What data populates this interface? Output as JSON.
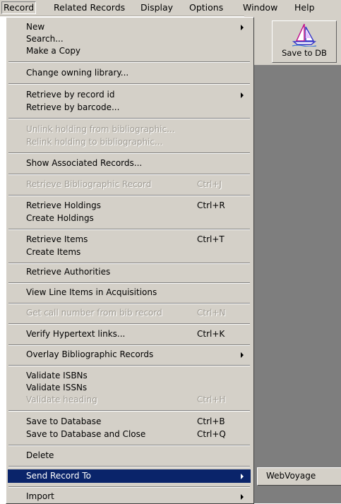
{
  "menubar": {
    "items": [
      "Record",
      "Related Records",
      "Display",
      "Options",
      "Window",
      "Help"
    ]
  },
  "toolbar": {
    "save_label": "Save to DB",
    "save_icon": "sailboat-icon"
  },
  "menu": {
    "items": [
      {
        "label": "New",
        "submenu": true
      },
      {
        "label": "Search..."
      },
      {
        "label": "Make a Copy"
      },
      {
        "label": "Change owning library..."
      },
      {
        "label": "Retrieve by record id",
        "submenu": true
      },
      {
        "label": "Retrieve by barcode..."
      },
      {
        "label": "Unlink holding from bibliographic...",
        "disabled": true
      },
      {
        "label": "Relink holding to bibliographic...",
        "disabled": true
      },
      {
        "label": "Show Associated Records..."
      },
      {
        "label": "Retrieve Bibliographic Record",
        "shortcut": "Ctrl+J",
        "disabled": true
      },
      {
        "label": "Retrieve Holdings",
        "shortcut": "Ctrl+R"
      },
      {
        "label": "Create Holdings"
      },
      {
        "label": "Retrieve Items",
        "shortcut": "Ctrl+T"
      },
      {
        "label": "Create Items"
      },
      {
        "label": "Retrieve Authorities"
      },
      {
        "label": "View Line Items in Acquisitions"
      },
      {
        "label": "Get call number from bib record",
        "shortcut": "Ctrl+N",
        "disabled": true
      },
      {
        "label": "Verify Hypertext links...",
        "shortcut": "Ctrl+K"
      },
      {
        "label": "Overlay Bibliographic Records",
        "submenu": true
      },
      {
        "label": "Validate ISBNs"
      },
      {
        "label": "Validate ISSNs"
      },
      {
        "label": "Validate heading",
        "shortcut": "Ctrl+H",
        "disabled": true
      },
      {
        "label": "Save to Database",
        "shortcut": "Ctrl+B"
      },
      {
        "label": "Save to Database and Close",
        "shortcut": "Ctrl+Q"
      },
      {
        "label": "Delete"
      },
      {
        "label": "Send Record To",
        "submenu": true,
        "selected": true
      },
      {
        "label": "Import",
        "submenu": true
      }
    ]
  },
  "submenu": {
    "items": [
      "WebVoyage"
    ]
  },
  "colors": {
    "menu_bg": "#d4d0c8",
    "highlight": "#0a246a",
    "disabled_text": "#a09c94",
    "workspace": "#7e7e7e"
  }
}
